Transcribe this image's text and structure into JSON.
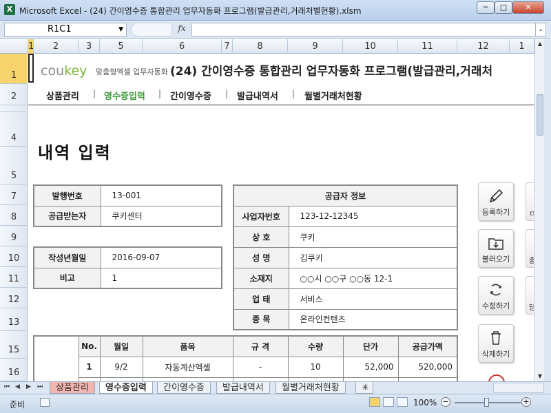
{
  "window": {
    "title": "Microsoft Excel - (24) 간이영수증 통합관리 업무자동화 프로그램(발급관리,거래처별현황).xlsm",
    "app_icon": "X",
    "min_glyph": "─",
    "max_glyph": "□",
    "close_glyph": "✕"
  },
  "formula_bar": {
    "name_box": "R1C1",
    "fx_label": "fx",
    "value": ""
  },
  "columns": [
    "1",
    "2",
    "3",
    "5",
    "6",
    "7",
    "8",
    "9",
    "10",
    "11",
    "12",
    "1"
  ],
  "rows": [
    "1",
    "2",
    "",
    "4",
    "5",
    "7",
    "8",
    "9",
    "10",
    "11",
    "12",
    "13",
    "15",
    "16"
  ],
  "header": {
    "logo_main": "cou",
    "logo_accent": "key",
    "logo_sub": "맞춤형엑셀 업무자동화",
    "title": "(24) 간이영수증 통합관리 업무자동화 프로그램(발급관리,거래처"
  },
  "menu": {
    "items": [
      "상품관리",
      "영수증입력",
      "간이영수증",
      "발급내역서",
      "월별거래처현황"
    ],
    "active_index": 1,
    "separator": "|"
  },
  "section_title": "내역 입력",
  "issue": {
    "no_label": "발행번호",
    "no_value": "13-001",
    "recipient_label": "공급받는자",
    "recipient_value": "쿠키센터"
  },
  "date_block": {
    "date_label": "작성년월일",
    "date_value": "2016-09-07",
    "note_label": "비고",
    "note_value": "1"
  },
  "supplier": {
    "header": "공급자 정보",
    "rows": [
      {
        "label": "사업자번호",
        "value": "123-12-12345"
      },
      {
        "label": "상 호",
        "value": "쿠키"
      },
      {
        "label": "성 명",
        "value": "김쿠키"
      },
      {
        "label": "소재지",
        "value": "○○시 ○○구 ○○동 12-1"
      },
      {
        "label": "업 태",
        "value": "서비스"
      },
      {
        "label": "종 목",
        "value": "온라인컨텐츠"
      }
    ]
  },
  "items_table": {
    "headers": [
      "No.",
      "월일",
      "품목",
      "규 격",
      "수량",
      "단가",
      "공급가액"
    ],
    "rows": [
      {
        "no": "1",
        "date": "9/2",
        "item": "자동계산엑셀",
        "spec": "-",
        "qty": "10",
        "unit_price": "52,000",
        "amount": "520,000"
      }
    ]
  },
  "actions": [
    {
      "label": "등록하기",
      "icon": "pencil-icon"
    },
    {
      "label": "불러오기",
      "icon": "folder-download-icon"
    },
    {
      "label": "수정하기",
      "icon": "refresh-icon"
    },
    {
      "label": "삭제하기",
      "icon": "trash-icon"
    }
  ],
  "actions_clipped": [
    "ㅁ",
    "출",
    "닫"
  ],
  "sheet_tabs": [
    "상품관리",
    "영수증입력",
    "간이영수증",
    "발급내역서",
    "월별거래처현황"
  ],
  "active_sheet": 1,
  "status": {
    "ready": "준비",
    "zoom": "100%"
  }
}
